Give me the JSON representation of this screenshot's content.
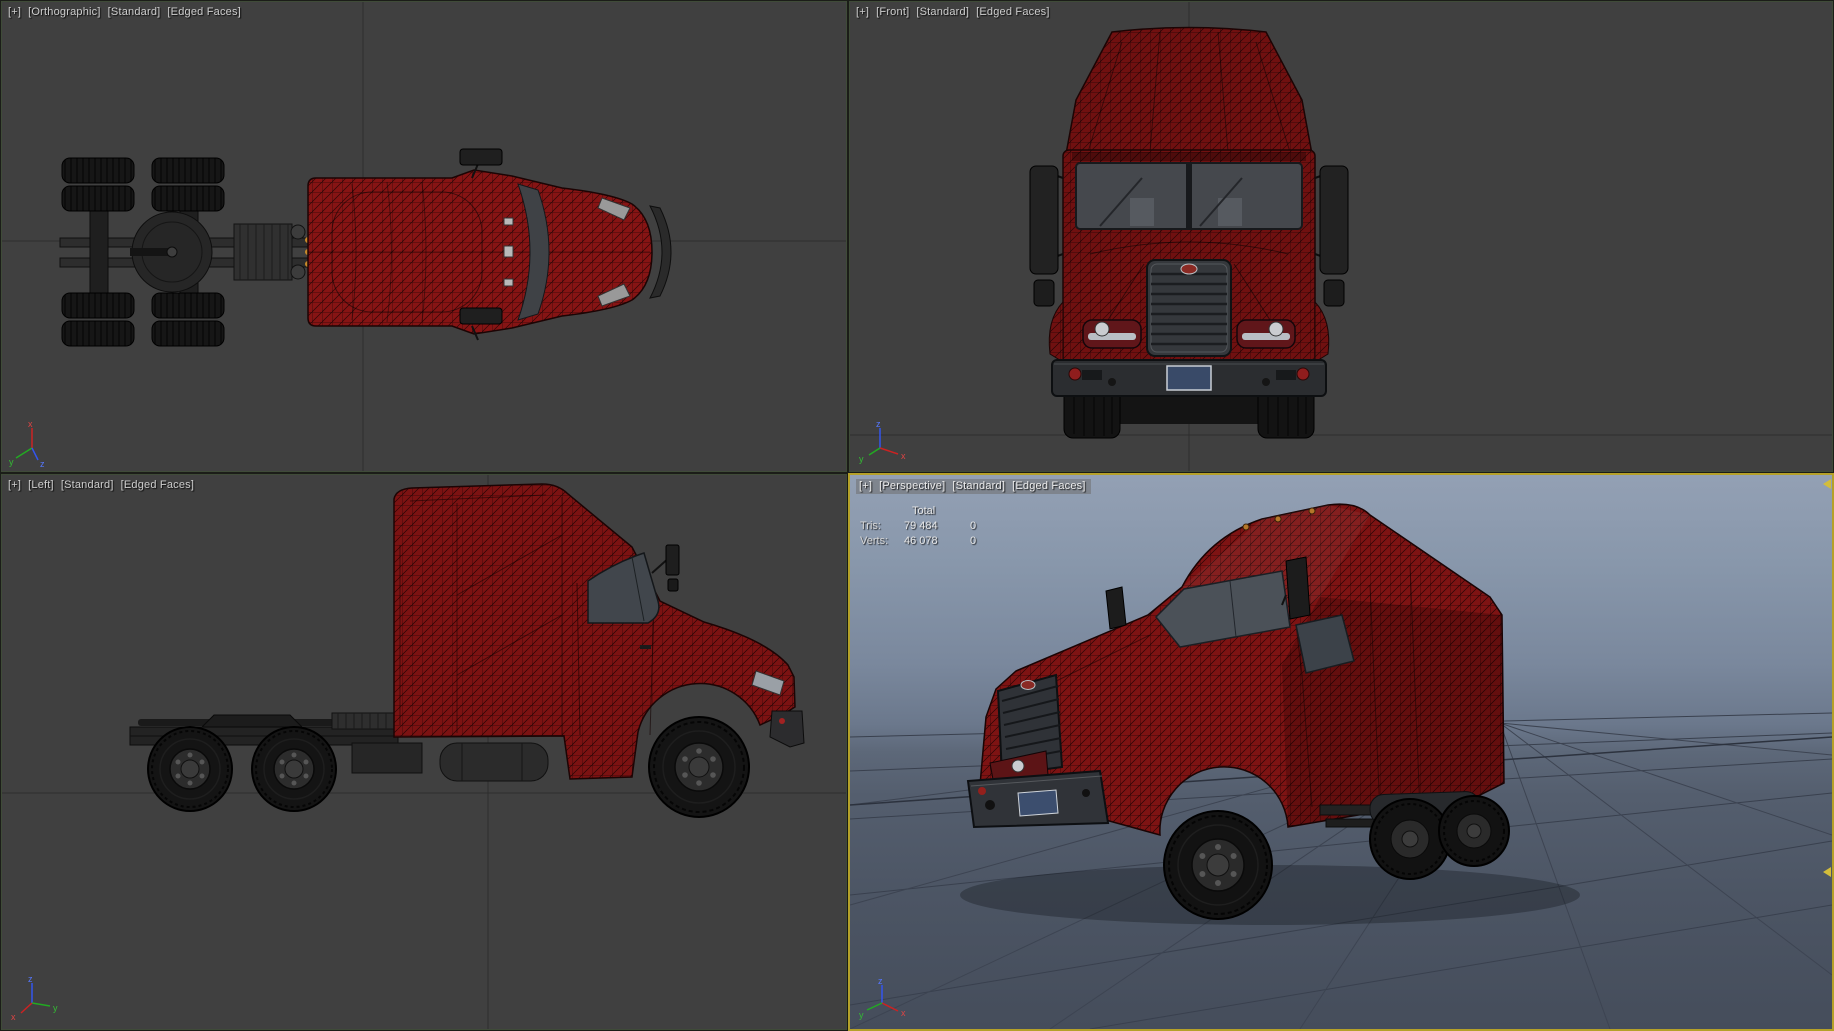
{
  "viewports": [
    {
      "id": "orthographic",
      "menu_plus": "[+]",
      "menu_view": "[Orthographic]",
      "menu_shading": "[Standard]",
      "menu_mode": "[Edged Faces]"
    },
    {
      "id": "front",
      "menu_plus": "[+]",
      "menu_view": "[Front]",
      "menu_shading": "[Standard]",
      "menu_mode": "[Edged Faces]"
    },
    {
      "id": "left",
      "menu_plus": "[+]",
      "menu_view": "[Left]",
      "menu_shading": "[Standard]",
      "menu_mode": "[Edged Faces]"
    },
    {
      "id": "perspective",
      "menu_plus": "[+]",
      "menu_view": "[Perspective]",
      "menu_shading": "[Standard]",
      "menu_mode": "[Edged Faces]"
    }
  ],
  "statistics": {
    "total_label": "Total",
    "rows": [
      {
        "label": "Tris:",
        "value": "79 484",
        "extra": "0"
      },
      {
        "label": "Verts:",
        "value": "46 078",
        "extra": "0"
      }
    ]
  },
  "axis_labels": {
    "x": "x",
    "y": "y",
    "z": "z"
  },
  "colors": {
    "ortho_background": "#404040",
    "grid_axis_line": "#2e2e2e",
    "inactive_border": "#3f4b38",
    "active_border": "#b5a129",
    "truck_body_red": "#7c1212",
    "wireframe_edge": "#2c0606",
    "sky_top": "#93a0b4",
    "ground_bottom": "#454d5b",
    "label_text": "#cdcdcd",
    "stats_text": "#e6e6e6"
  }
}
